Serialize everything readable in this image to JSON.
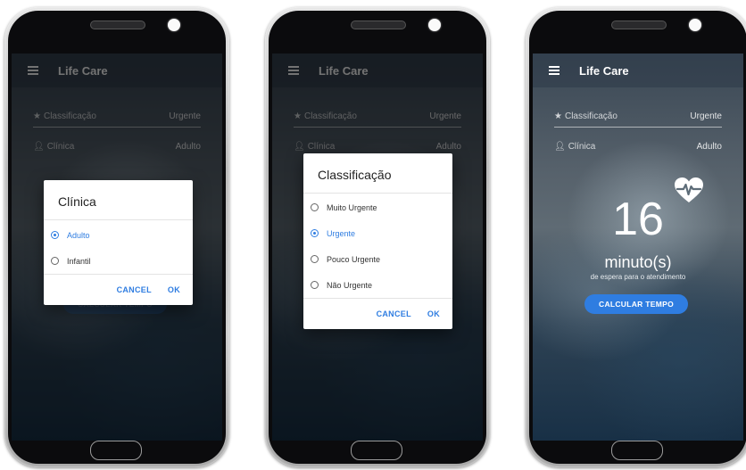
{
  "app": {
    "title": "Life Care"
  },
  "fields": {
    "classificacao_label": "Classificação",
    "classificacao_value": "Urgente",
    "clinica_label": "Clínica",
    "clinica_value": "Adulto"
  },
  "dialog_clinica": {
    "title": "Clínica",
    "options": [
      "Adulto",
      "Infantil"
    ],
    "selected": "Adulto",
    "cancel": "CANCEL",
    "ok": "OK"
  },
  "dialog_classificacao": {
    "title": "Classificação",
    "options": [
      "Muito Urgente",
      "Urgente",
      "Pouco Urgente",
      "Não Urgente"
    ],
    "selected": "Urgente",
    "cancel": "CANCEL",
    "ok": "OK"
  },
  "result": {
    "minutes": "16",
    "unit": "minuto(s)",
    "caption": "de espera para o atendimento",
    "button": "CALCULAR TEMPO"
  },
  "colors": {
    "accent": "#2f7de1",
    "text_dark": "#222222"
  },
  "icons": {
    "menu": "menu-icon",
    "star": "star-icon",
    "person": "person-icon",
    "heart": "heartbeat-icon"
  }
}
